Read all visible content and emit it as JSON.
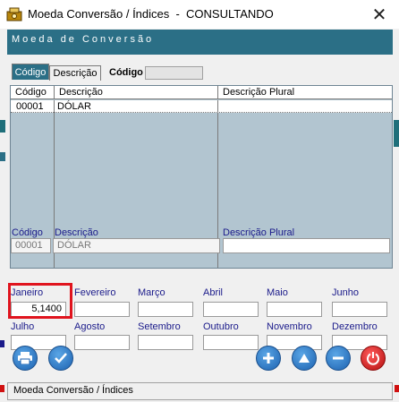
{
  "window": {
    "title": "Moeda Conversão / Índices  -  CONSULTANDO",
    "close_glyph": "✕"
  },
  "header": {
    "label": "Moeda de Conversão"
  },
  "tabs": [
    {
      "label": "Código",
      "active": true
    },
    {
      "label": "Descrição",
      "active": false
    }
  ],
  "sort": {
    "label": "Código",
    "value": ""
  },
  "grid": {
    "columns": [
      "Código",
      "Descrição",
      "Descrição Plural"
    ],
    "rows": [
      {
        "codigo": "00001",
        "descricao": "DÓLAR",
        "plural": ""
      }
    ]
  },
  "detail": {
    "codigo_label": "Código",
    "descricao_label": "Descrição",
    "plural_label": "Descrição Plural",
    "codigo": "00001",
    "descricao": "DÓLAR",
    "plural": ""
  },
  "months": [
    {
      "label": "Janeiro",
      "value": "5,1400"
    },
    {
      "label": "Fevereiro",
      "value": ""
    },
    {
      "label": "Março",
      "value": ""
    },
    {
      "label": "Abril",
      "value": ""
    },
    {
      "label": "Maio",
      "value": ""
    },
    {
      "label": "Junho",
      "value": ""
    },
    {
      "label": "Julho",
      "value": ""
    },
    {
      "label": "Agosto",
      "value": ""
    },
    {
      "label": "Setembro",
      "value": ""
    },
    {
      "label": "Outubro",
      "value": ""
    },
    {
      "label": "Novembro",
      "value": ""
    },
    {
      "label": "Dezembro",
      "value": ""
    }
  ],
  "toolbar": {
    "print_icon": "printer-icon",
    "confirm_icon": "checkmark-icon",
    "add_icon": "plus-icon",
    "up_icon": "triangle-up-icon",
    "remove_icon": "minus-icon",
    "exit_icon": "power-icon"
  },
  "status": {
    "text": "Moeda Conversão / Índices"
  },
  "colors": {
    "header": "#2b6f86",
    "grid_bg": "#b2c5d0",
    "label": "#1a1a8a",
    "highlight": "#e0141e",
    "button_blue": "#1d62b0",
    "button_red": "#b40f0f"
  }
}
